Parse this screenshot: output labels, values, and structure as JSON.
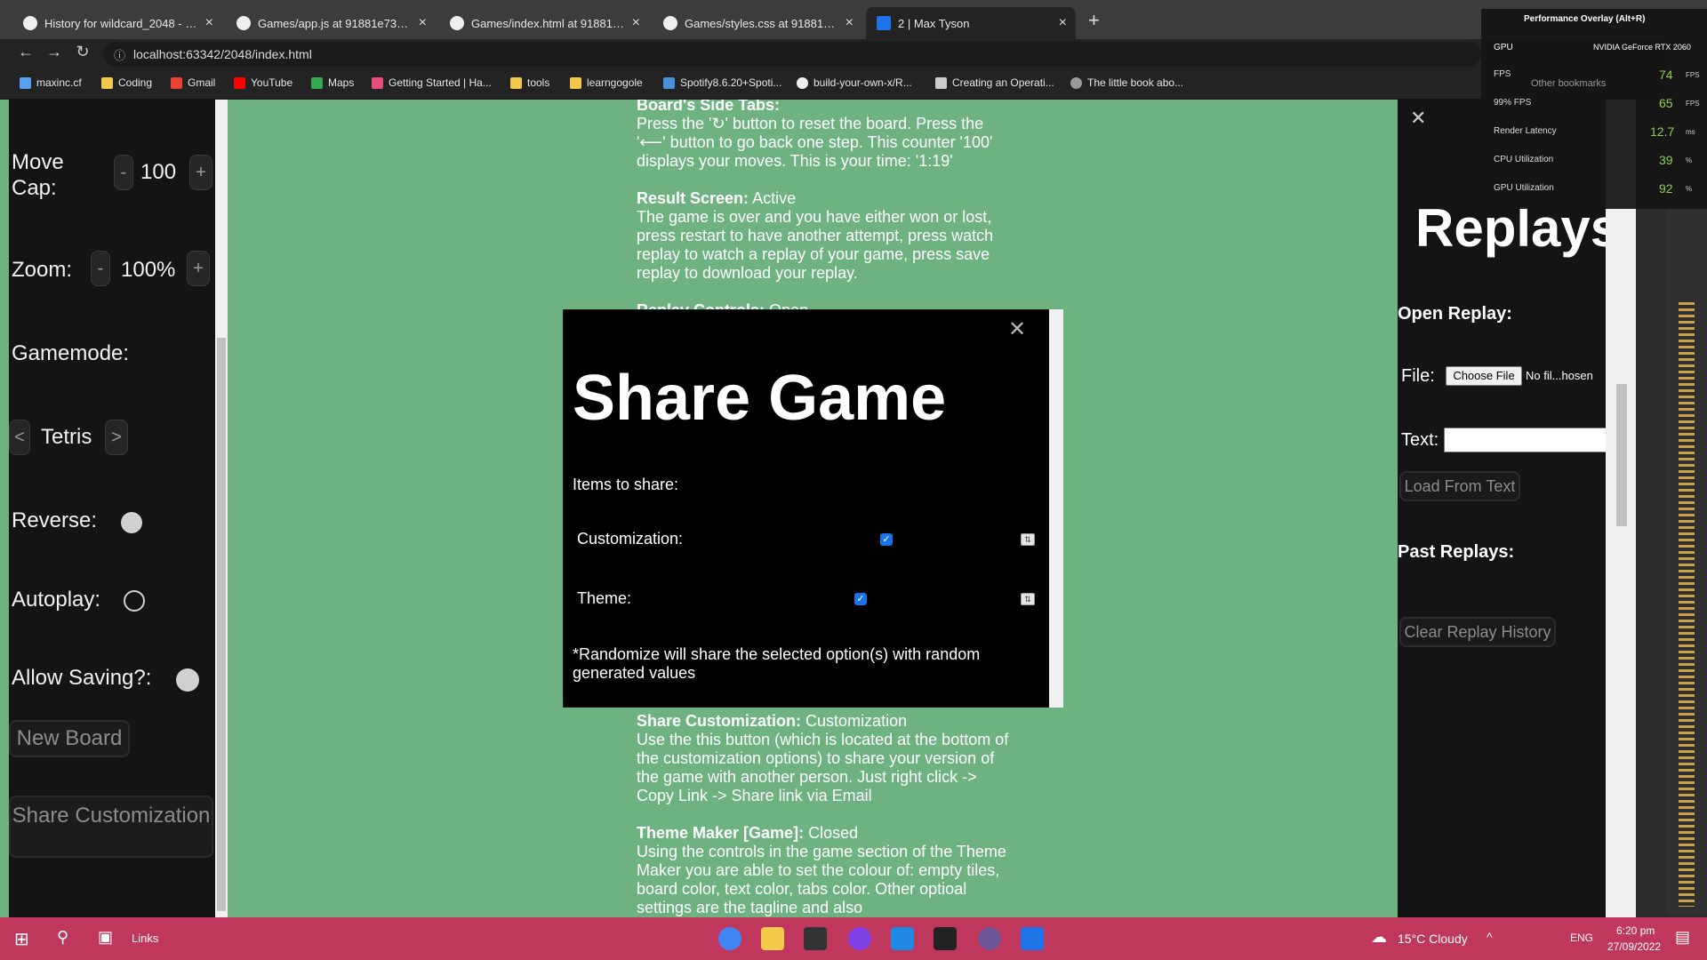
{
  "browser": {
    "tabs": [
      {
        "label": "History for wildcard_2048 - maxt"
      },
      {
        "label": "Games/app.js at 91881e7398bad"
      },
      {
        "label": "Games/index.html at 91881e739"
      },
      {
        "label": "Games/styles.css at 91881e7398"
      },
      {
        "label": "2 | Max Tyson"
      }
    ],
    "url": "localhost:63342/2048/index.html",
    "bookmarks": [
      "maxinc.cf",
      "Coding",
      "Gmail",
      "YouTube",
      "Maps",
      "Getting Started | Ha...",
      "tools",
      "learngogole",
      "Spotify8.6.20+Spoti...",
      "build-your-own-x/R...",
      "Creating an Operati...",
      "The little book abo..."
    ],
    "other_bookmarks": "Other bookmarks"
  },
  "left_panel": {
    "move_cap_label": "Move Cap:",
    "move_cap_value": "100",
    "zoom_label": "Zoom:",
    "zoom_value": "100%",
    "gamemode_label": "Gamemode:",
    "gamemode_value": "Tetris",
    "reverse_label": "Reverse:",
    "autoplay_label": "Autoplay:",
    "allow_saving_label": "Allow Saving?:",
    "new_board_label": "New Board",
    "share_customization_label": "Share Customization",
    "minus": "-",
    "plus": "+",
    "prev": "<",
    "next": ">"
  },
  "help": {
    "board_side_title": "Board's Side Tabs:",
    "board_side_text": "Press the '↻' button to reset the board. Press the '⟵' button to go back one step. This counter '100' displays your moves. This is your time: '1:19'",
    "result_title": "Result Screen:",
    "result_state": "Active",
    "result_text": "The game is over and you have either won or lost, press restart to have another attempt, press watch replay to watch a replay of your game, press save replay to download your replay.",
    "replay_title": "Replay Controls:",
    "replay_state": "Open",
    "share_title": "Share Customization:",
    "share_state": "Customization",
    "share_text": "Use the this button (which is located at the bottom of the customization options) to share your version of the game with another person. Just right click -> Copy Link -> Share link via Email",
    "theme_title": "Theme Maker [Game]:",
    "theme_state": "Closed",
    "theme_text": "Using the controls in the game section of the Theme Maker you are able to set the colour of: empty tiles, board color, text color, tabs color. Other optioal settings are the tagline and also"
  },
  "modal": {
    "title": "Share Game",
    "items_label": "Items to share:",
    "customization_label": "Customization:",
    "theme_label": "Theme:",
    "note": "*Randomize will share the selected option(s) with random generated values",
    "close": "✕"
  },
  "right_panel": {
    "title": "Replays",
    "open_replay": "Open Replay:",
    "file_label": "File:",
    "choose_file": "Choose File",
    "file_status": "No fil...hosen",
    "text_label": "Text:",
    "load_from_text": "Load From Text",
    "past_replays": "Past Replays:",
    "clear_history": "Clear Replay History",
    "close": "✕"
  },
  "overlay": {
    "title": "Performance Overlay (Alt+R)",
    "gpu_label": "GPU",
    "gpu_name": "NVIDIA GeForce RTX 2060",
    "rows": [
      {
        "label": "FPS",
        "value": "74",
        "unit": "FPS"
      },
      {
        "label": "99% FPS",
        "value": "65",
        "unit": "FPS"
      },
      {
        "label": "Render Latency",
        "value": "12.7",
        "unit": "ms"
      },
      {
        "label": "CPU Utilization",
        "value": "39",
        "unit": "%"
      },
      {
        "label": "GPU Utilization",
        "value": "92",
        "unit": "%"
      }
    ]
  },
  "taskbar": {
    "links": "Links",
    "weather": "15°C  Cloudy",
    "lang": "ENG",
    "time": "6:20 pm",
    "date": "27/09/2022"
  },
  "colors": {
    "page_bg": "#6fb282",
    "panel_bg": "#141414",
    "taskbar": "#c0375e",
    "checkbox": "#1a73e8"
  }
}
